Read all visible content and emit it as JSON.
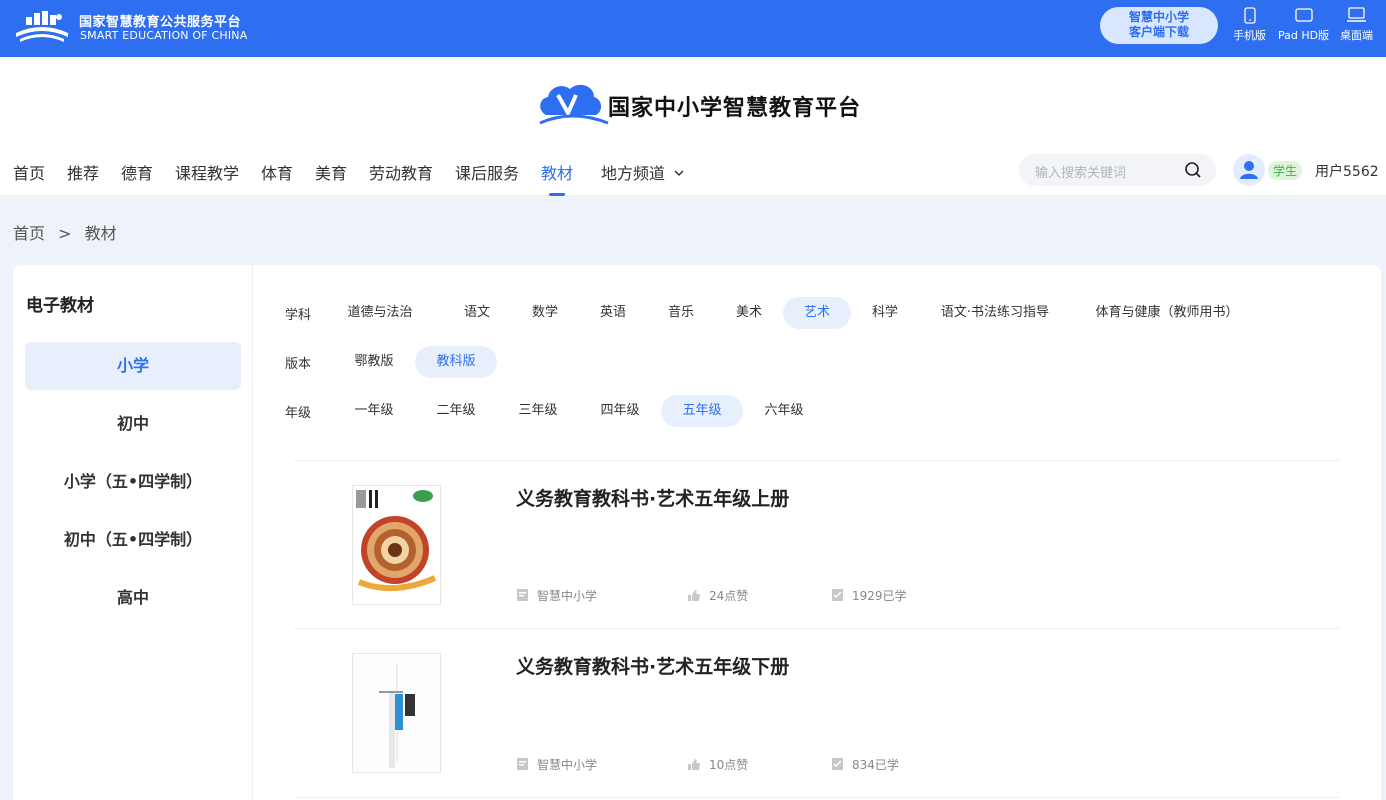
{
  "topbar": {
    "brand_cn": "国家智慧教育公共服务平台",
    "brand_en": "SMART EDUCATION OF CHINA",
    "download_line1": "智慧中小学",
    "download_line2": "客户端下载",
    "devices": [
      "手机版",
      "Pad HD版",
      "桌面端"
    ]
  },
  "header": {
    "site_title": "国家中小学智慧教育平台",
    "nav": [
      "首页",
      "推荐",
      "德育",
      "课程教学",
      "体育",
      "美育",
      "劳动教育",
      "课后服务",
      "教材",
      "地方频道"
    ],
    "active_nav": "教材",
    "search_placeholder": "输入搜索关键词",
    "role": "学生",
    "user": "用户5562"
  },
  "breadcrumb": [
    "首页",
    ">",
    "教材"
  ],
  "sidebar": {
    "title": "电子教材",
    "items": [
      "小学",
      "初中",
      "小学（五•四学制）",
      "初中（五•四学制）",
      "高中"
    ],
    "active": "小学"
  },
  "filters": {
    "subject_label": "学科",
    "subjects": [
      "道德与法治",
      "语文",
      "数学",
      "英语",
      "音乐",
      "美术",
      "艺术",
      "科学",
      "语文·书法练习指导",
      "体育与健康（教师用书）"
    ],
    "active_subject": "艺术",
    "edition_label": "版本",
    "editions": [
      "鄂教版",
      "教科版"
    ],
    "active_edition": "教科版",
    "grade_label": "年级",
    "grades": [
      "一年级",
      "二年级",
      "三年级",
      "四年级",
      "五年级",
      "六年级"
    ],
    "active_grade": "五年级"
  },
  "books": [
    {
      "title": "义务教育教科书·艺术五年级上册",
      "source": "智慧中小学",
      "likes": "24点赞",
      "learners": "1929已学"
    },
    {
      "title": "义务教育教科书·艺术五年级下册",
      "source": "智慧中小学",
      "likes": "10点赞",
      "learners": "834已学"
    }
  ],
  "colors": {
    "primary": "#2d6ff0",
    "active_bg": "#e8effc",
    "role_badge": "#3bb24a"
  }
}
